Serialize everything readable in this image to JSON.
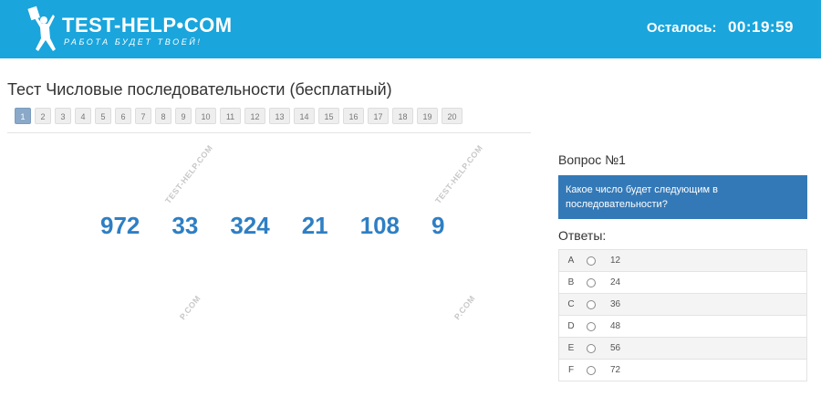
{
  "header": {
    "logo_title": "TEST-HELP•COM",
    "logo_subtitle": "РАБОТА БУДЕТ ТВОЕЙ!",
    "timer_label": "Осталось:",
    "timer_value": "00:19:59",
    "background_color": "#1aa5dc"
  },
  "page_title": "Тест Числовые последовательности (бесплатный)",
  "pagination": {
    "items": [
      "1",
      "2",
      "3",
      "4",
      "5",
      "6",
      "7",
      "8",
      "9",
      "10",
      "11",
      "12",
      "13",
      "14",
      "15",
      "16",
      "17",
      "18",
      "19",
      "20"
    ],
    "active": "1"
  },
  "watermarks": [
    "TEST-HELP.COM",
    "TEST-HELP.COM",
    "P.COM",
    "P.COM"
  ],
  "sequence": [
    "972",
    "33",
    "324",
    "21",
    "108",
    "9"
  ],
  "question": {
    "heading": "Вопрос №1",
    "text": "Какое число будет следующим в последовательности?"
  },
  "answers": {
    "heading": "Ответы:",
    "options": [
      {
        "letter": "A",
        "value": "12"
      },
      {
        "letter": "B",
        "value": "24"
      },
      {
        "letter": "C",
        "value": "36"
      },
      {
        "letter": "D",
        "value": "48"
      },
      {
        "letter": "E",
        "value": "56"
      },
      {
        "letter": "F",
        "value": "72"
      }
    ]
  },
  "colors": {
    "accent": "#1aa5dc",
    "question_box": "#3479b7",
    "sequence_text": "#2e7fc4"
  }
}
